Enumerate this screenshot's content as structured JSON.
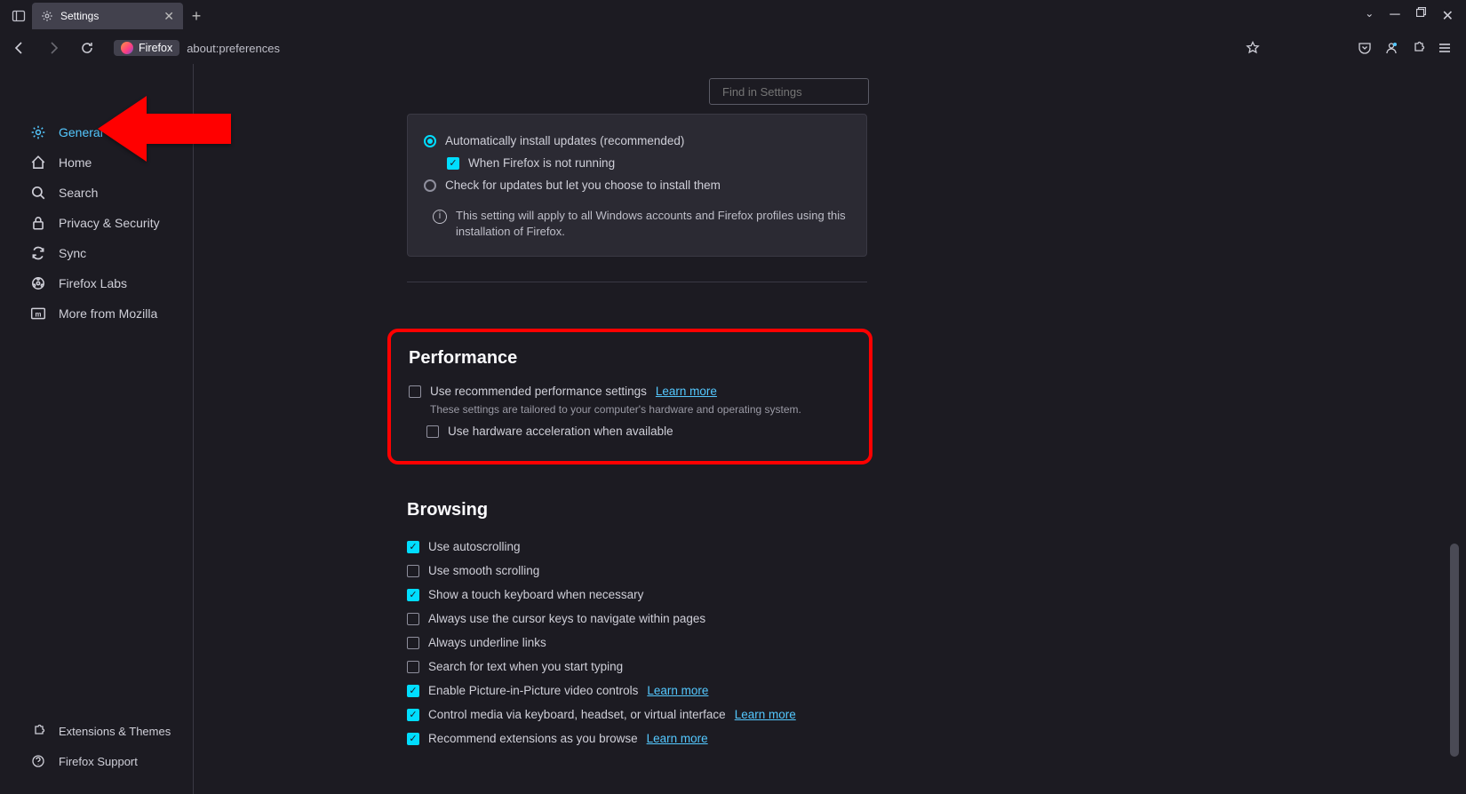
{
  "tab": {
    "title": "Settings"
  },
  "addr": {
    "badge": "Firefox",
    "url": "about:preferences"
  },
  "search": {
    "placeholder": "Find in Settings"
  },
  "sidebar": {
    "items": [
      {
        "label": "General"
      },
      {
        "label": "Home"
      },
      {
        "label": "Search"
      },
      {
        "label": "Privacy & Security"
      },
      {
        "label": "Sync"
      },
      {
        "label": "Firefox Labs"
      },
      {
        "label": "More from Mozilla"
      }
    ],
    "bottom": [
      {
        "label": "Extensions & Themes"
      },
      {
        "label": "Firefox Support"
      }
    ]
  },
  "updates": {
    "auto": "Automatically install updates (recommended)",
    "when_not_running": "When Firefox is not running",
    "check_only": "Check for updates but let you choose to install them",
    "info": "This setting will apply to all Windows accounts and Firefox profiles using this installation of Firefox."
  },
  "performance": {
    "title": "Performance",
    "use_recommended": "Use recommended performance settings",
    "learn_more": "Learn more",
    "desc": "These settings are tailored to your computer's hardware and operating system.",
    "hw_accel": "Use hardware acceleration when available"
  },
  "browsing": {
    "title": "Browsing",
    "autoscroll": "Use autoscrolling",
    "smooth": "Use smooth scrolling",
    "touch_kb": "Show a touch keyboard when necessary",
    "cursor_keys": "Always use the cursor keys to navigate within pages",
    "underline_links": "Always underline links",
    "search_typing": "Search for text when you start typing",
    "pip": "Enable Picture-in-Picture video controls",
    "pip_learn": "Learn more",
    "media_keys": "Control media via keyboard, headset, or virtual interface",
    "media_learn": "Learn more",
    "recommend_ext": "Recommend extensions as you browse",
    "recommend_learn": "Learn more"
  }
}
